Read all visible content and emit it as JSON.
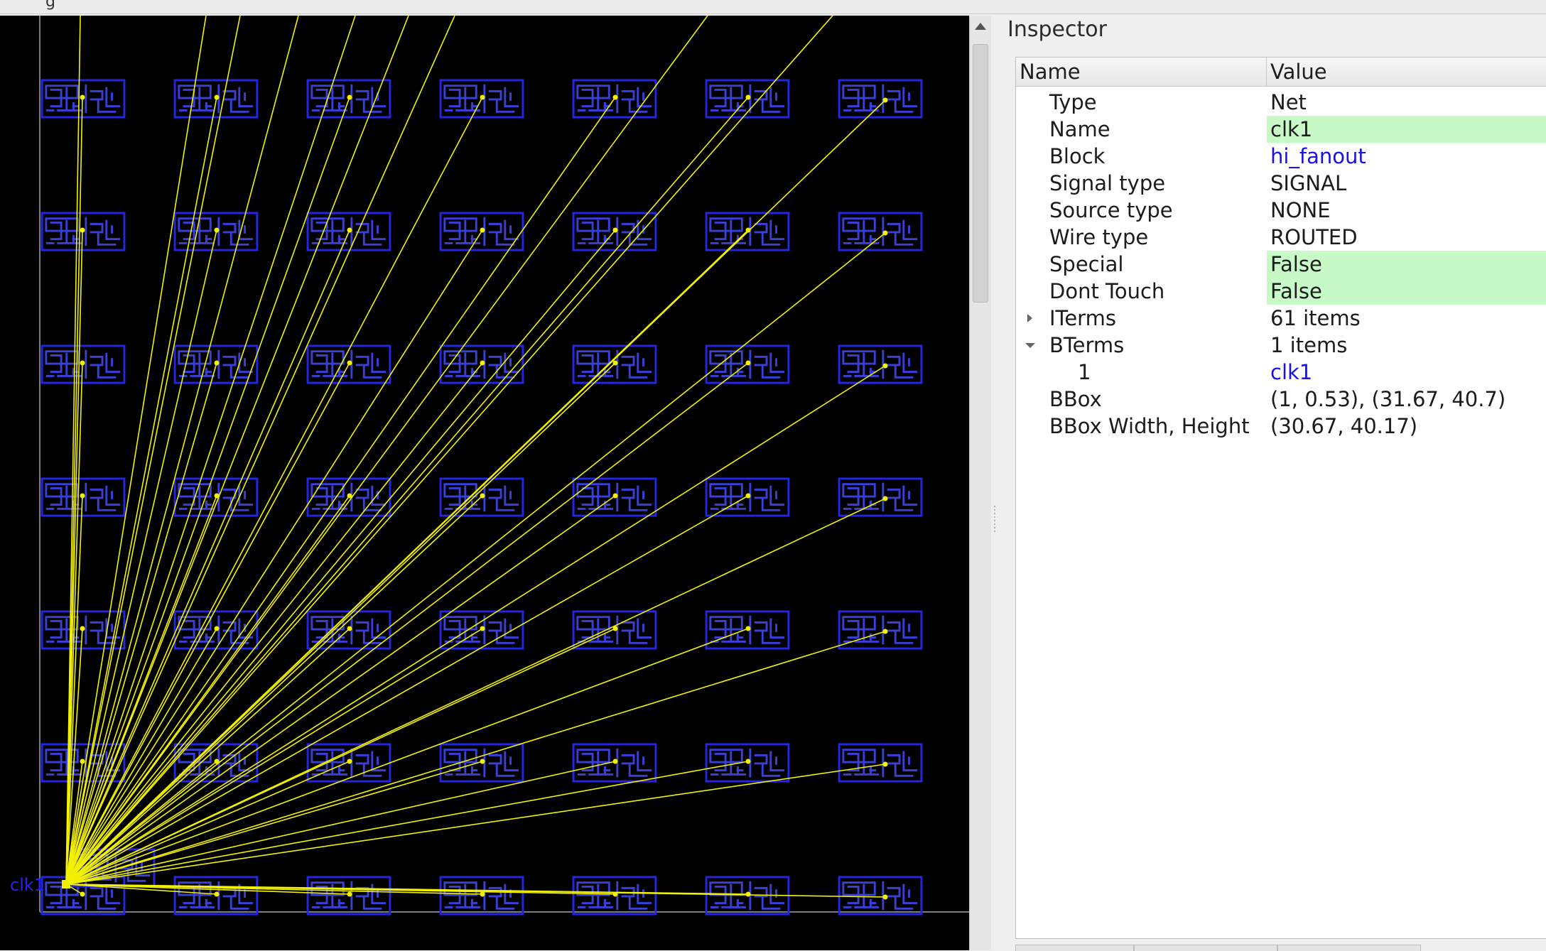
{
  "top_bar": {
    "fragment": "g"
  },
  "layout_view": {
    "bterm_label": "clk1",
    "colors": {
      "background": "#000000",
      "cell_outline": "#2426e6",
      "cell_inner": "#3a3fd8",
      "flightline": "#f2f200",
      "die_boundary": "#7c7c7c",
      "label": "#2a22ee"
    },
    "grid": {
      "columns": 7,
      "rows": 7
    }
  },
  "inspector": {
    "title": "Inspector",
    "columns": {
      "name": "Name",
      "value": "Value"
    },
    "rows": [
      {
        "name": "Type",
        "value": "Net"
      },
      {
        "name": "Name",
        "value": "clk1"
      },
      {
        "name": "Block",
        "value": "hi_fanout"
      },
      {
        "name": "Signal type",
        "value": "SIGNAL"
      },
      {
        "name": "Source type",
        "value": "NONE"
      },
      {
        "name": "Wire type",
        "value": "ROUTED"
      },
      {
        "name": "Special",
        "value": "False"
      },
      {
        "name": "Dont Touch",
        "value": "False"
      },
      {
        "name": "ITerms",
        "value": "61 items"
      },
      {
        "name": "BTerms",
        "value": "1 items"
      },
      {
        "name": "1",
        "value": "clk1"
      },
      {
        "name": "BBox",
        "value": "(1, 0.53), (31.67, 40.7)"
      },
      {
        "name": "BBox Width, Height",
        "value": "(30.67, 40.17)"
      }
    ]
  }
}
